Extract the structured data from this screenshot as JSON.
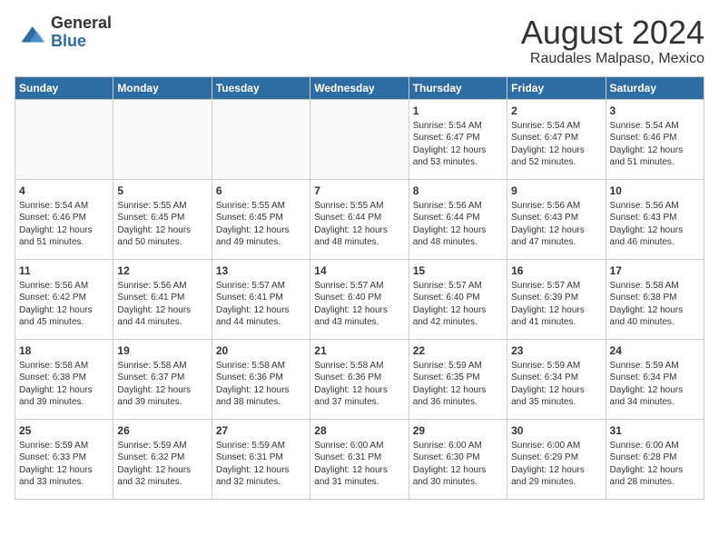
{
  "logo": {
    "text_general": "General",
    "text_blue": "Blue"
  },
  "title": "August 2024",
  "subtitle": "Raudales Malpaso, Mexico",
  "days_of_week": [
    "Sunday",
    "Monday",
    "Tuesday",
    "Wednesday",
    "Thursday",
    "Friday",
    "Saturday"
  ],
  "weeks": [
    [
      {
        "day": "",
        "info": ""
      },
      {
        "day": "",
        "info": ""
      },
      {
        "day": "",
        "info": ""
      },
      {
        "day": "",
        "info": ""
      },
      {
        "day": "1",
        "info": "Sunrise: 5:54 AM\nSunset: 6:47 PM\nDaylight: 12 hours\nand 53 minutes."
      },
      {
        "day": "2",
        "info": "Sunrise: 5:54 AM\nSunset: 6:47 PM\nDaylight: 12 hours\nand 52 minutes."
      },
      {
        "day": "3",
        "info": "Sunrise: 5:54 AM\nSunset: 6:46 PM\nDaylight: 12 hours\nand 51 minutes."
      }
    ],
    [
      {
        "day": "4",
        "info": "Sunrise: 5:54 AM\nSunset: 6:46 PM\nDaylight: 12 hours\nand 51 minutes."
      },
      {
        "day": "5",
        "info": "Sunrise: 5:55 AM\nSunset: 6:45 PM\nDaylight: 12 hours\nand 50 minutes."
      },
      {
        "day": "6",
        "info": "Sunrise: 5:55 AM\nSunset: 6:45 PM\nDaylight: 12 hours\nand 49 minutes."
      },
      {
        "day": "7",
        "info": "Sunrise: 5:55 AM\nSunset: 6:44 PM\nDaylight: 12 hours\nand 48 minutes."
      },
      {
        "day": "8",
        "info": "Sunrise: 5:56 AM\nSunset: 6:44 PM\nDaylight: 12 hours\nand 48 minutes."
      },
      {
        "day": "9",
        "info": "Sunrise: 5:56 AM\nSunset: 6:43 PM\nDaylight: 12 hours\nand 47 minutes."
      },
      {
        "day": "10",
        "info": "Sunrise: 5:56 AM\nSunset: 6:43 PM\nDaylight: 12 hours\nand 46 minutes."
      }
    ],
    [
      {
        "day": "11",
        "info": "Sunrise: 5:56 AM\nSunset: 6:42 PM\nDaylight: 12 hours\nand 45 minutes."
      },
      {
        "day": "12",
        "info": "Sunrise: 5:56 AM\nSunset: 6:41 PM\nDaylight: 12 hours\nand 44 minutes."
      },
      {
        "day": "13",
        "info": "Sunrise: 5:57 AM\nSunset: 6:41 PM\nDaylight: 12 hours\nand 44 minutes."
      },
      {
        "day": "14",
        "info": "Sunrise: 5:57 AM\nSunset: 6:40 PM\nDaylight: 12 hours\nand 43 minutes."
      },
      {
        "day": "15",
        "info": "Sunrise: 5:57 AM\nSunset: 6:40 PM\nDaylight: 12 hours\nand 42 minutes."
      },
      {
        "day": "16",
        "info": "Sunrise: 5:57 AM\nSunset: 6:39 PM\nDaylight: 12 hours\nand 41 minutes."
      },
      {
        "day": "17",
        "info": "Sunrise: 5:58 AM\nSunset: 6:38 PM\nDaylight: 12 hours\nand 40 minutes."
      }
    ],
    [
      {
        "day": "18",
        "info": "Sunrise: 5:58 AM\nSunset: 6:38 PM\nDaylight: 12 hours\nand 39 minutes."
      },
      {
        "day": "19",
        "info": "Sunrise: 5:58 AM\nSunset: 6:37 PM\nDaylight: 12 hours\nand 39 minutes."
      },
      {
        "day": "20",
        "info": "Sunrise: 5:58 AM\nSunset: 6:36 PM\nDaylight: 12 hours\nand 38 minutes."
      },
      {
        "day": "21",
        "info": "Sunrise: 5:58 AM\nSunset: 6:36 PM\nDaylight: 12 hours\nand 37 minutes."
      },
      {
        "day": "22",
        "info": "Sunrise: 5:59 AM\nSunset: 6:35 PM\nDaylight: 12 hours\nand 36 minutes."
      },
      {
        "day": "23",
        "info": "Sunrise: 5:59 AM\nSunset: 6:34 PM\nDaylight: 12 hours\nand 35 minutes."
      },
      {
        "day": "24",
        "info": "Sunrise: 5:59 AM\nSunset: 6:34 PM\nDaylight: 12 hours\nand 34 minutes."
      }
    ],
    [
      {
        "day": "25",
        "info": "Sunrise: 5:59 AM\nSunset: 6:33 PM\nDaylight: 12 hours\nand 33 minutes."
      },
      {
        "day": "26",
        "info": "Sunrise: 5:59 AM\nSunset: 6:32 PM\nDaylight: 12 hours\nand 32 minutes."
      },
      {
        "day": "27",
        "info": "Sunrise: 5:59 AM\nSunset: 6:31 PM\nDaylight: 12 hours\nand 32 minutes."
      },
      {
        "day": "28",
        "info": "Sunrise: 6:00 AM\nSunset: 6:31 PM\nDaylight: 12 hours\nand 31 minutes."
      },
      {
        "day": "29",
        "info": "Sunrise: 6:00 AM\nSunset: 6:30 PM\nDaylight: 12 hours\nand 30 minutes."
      },
      {
        "day": "30",
        "info": "Sunrise: 6:00 AM\nSunset: 6:29 PM\nDaylight: 12 hours\nand 29 minutes."
      },
      {
        "day": "31",
        "info": "Sunrise: 6:00 AM\nSunset: 6:28 PM\nDaylight: 12 hours\nand 28 minutes."
      }
    ]
  ]
}
